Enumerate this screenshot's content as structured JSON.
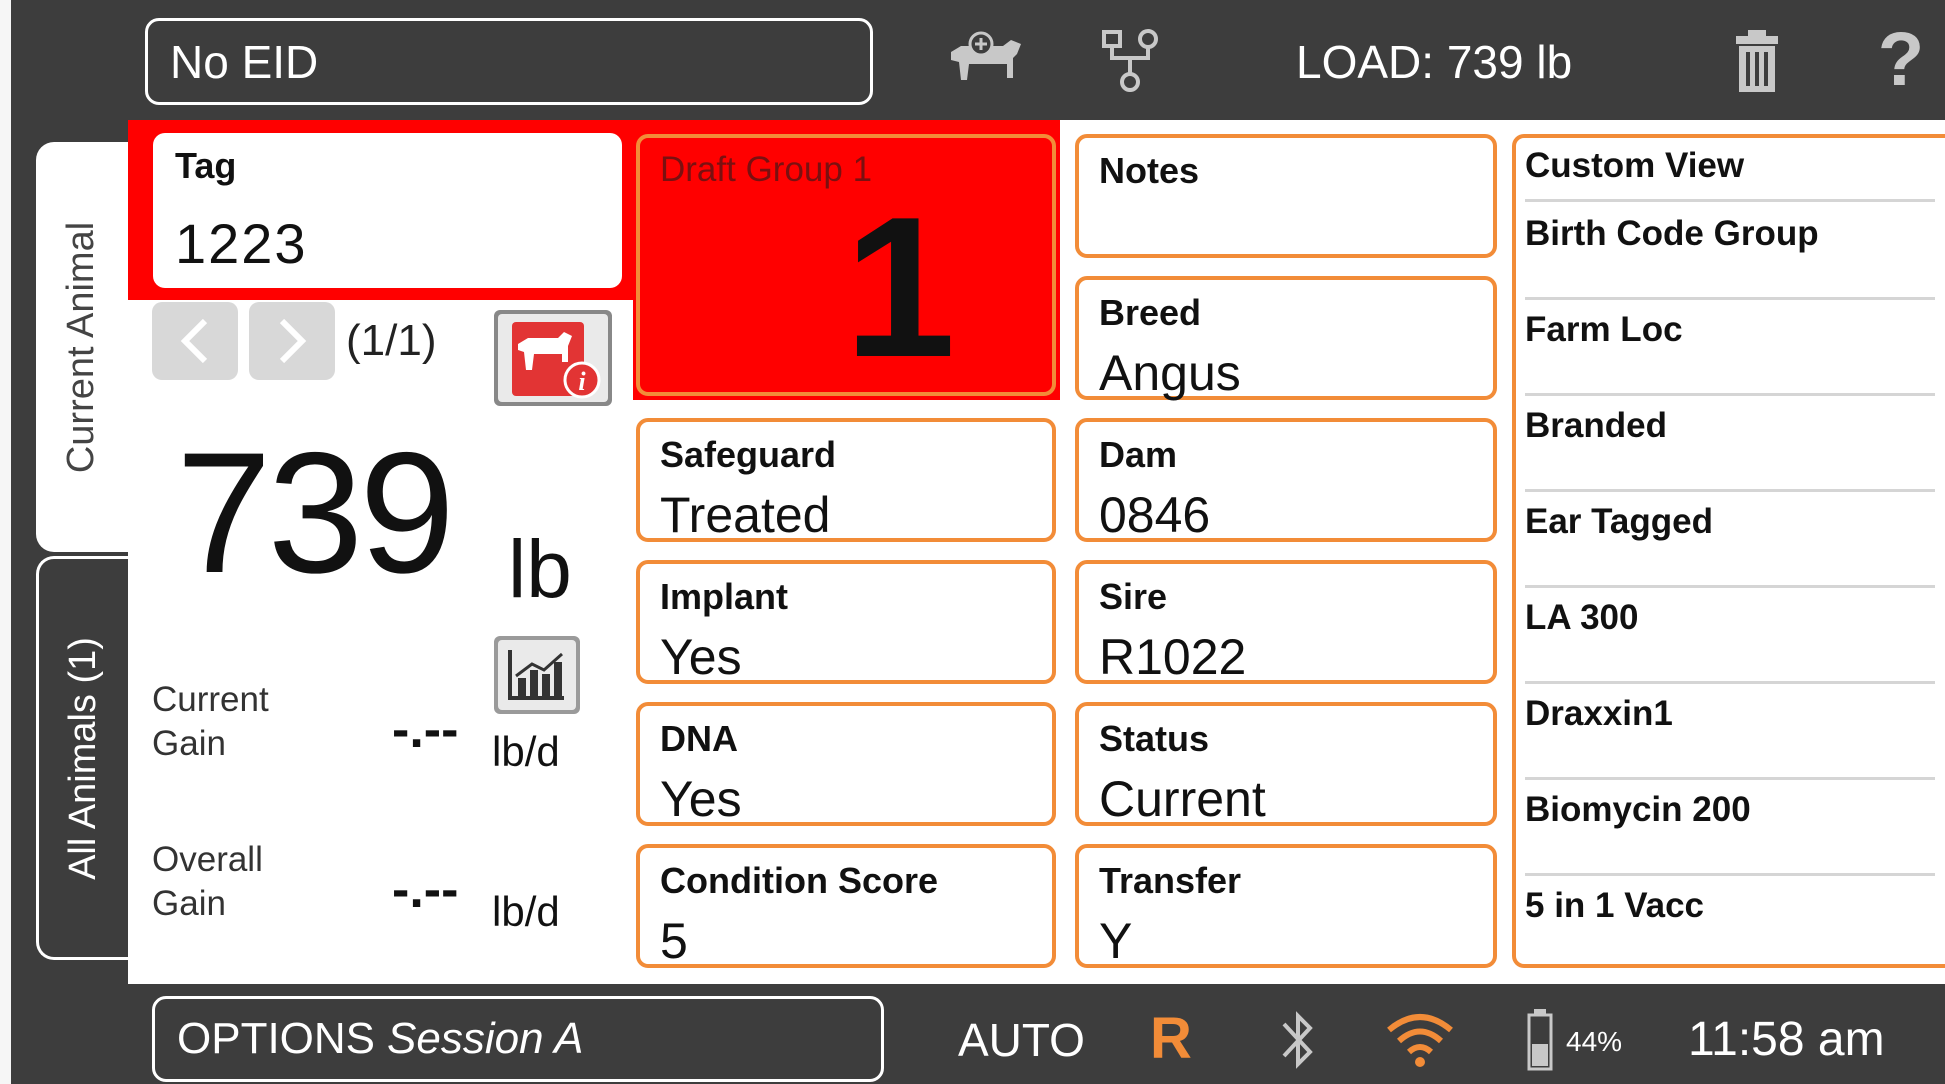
{
  "header": {
    "eid_field": "No EID",
    "load_label": "LOAD: 739 lb",
    "icons": [
      "cow-add-icon",
      "network-icon",
      "trash-icon",
      "help-icon"
    ]
  },
  "tabs": {
    "current_animal": "Current Animal",
    "all_animals": "All Animals (1)"
  },
  "tag": {
    "label": "Tag",
    "value": "1223"
  },
  "navigation": {
    "position": "(1/1)"
  },
  "weight": {
    "value": "739",
    "unit": "lb"
  },
  "gain": {
    "current_label_1": "Current",
    "current_label_2": "Gain",
    "current_value": "-.--",
    "current_unit": "lb/d",
    "overall_label_1": "Overall",
    "overall_label_2": "Gain",
    "overall_value": "-.--",
    "overall_unit": "lb/d"
  },
  "draft_group": {
    "label": "Draft Group 1",
    "value": "1",
    "color": "#ff0000"
  },
  "fields_col1": [
    {
      "label": "Safeguard",
      "value": "Treated"
    },
    {
      "label": "Implant",
      "value": "Yes"
    },
    {
      "label": "DNA",
      "value": "Yes"
    },
    {
      "label": "Condition Score",
      "value": "5"
    }
  ],
  "fields_col2": [
    {
      "label": "Notes",
      "value": ""
    },
    {
      "label": "Breed",
      "value": "Angus"
    },
    {
      "label": "Dam",
      "value": "0846"
    },
    {
      "label": "Sire",
      "value": "R1022"
    },
    {
      "label": "Status",
      "value": "Current"
    },
    {
      "label": "Transfer",
      "value": "Y"
    }
  ],
  "custom_view": {
    "title": "Custom View",
    "items": [
      "Birth Code Group",
      "Farm Loc",
      "Branded",
      "Ear Tagged",
      "LA 300",
      "Draxxin1",
      "Biomycin 200",
      "5 in 1 Vacc"
    ]
  },
  "footer": {
    "options_label": "OPTIONS",
    "session_label": "Session A",
    "mode": "AUTO",
    "r_indicator": "R",
    "battery": "44%",
    "time": "11:58 am"
  },
  "colors": {
    "accent_orange": "#f28c38",
    "draft_red": "#ff0000",
    "dark_bar": "#3d3d3d"
  }
}
